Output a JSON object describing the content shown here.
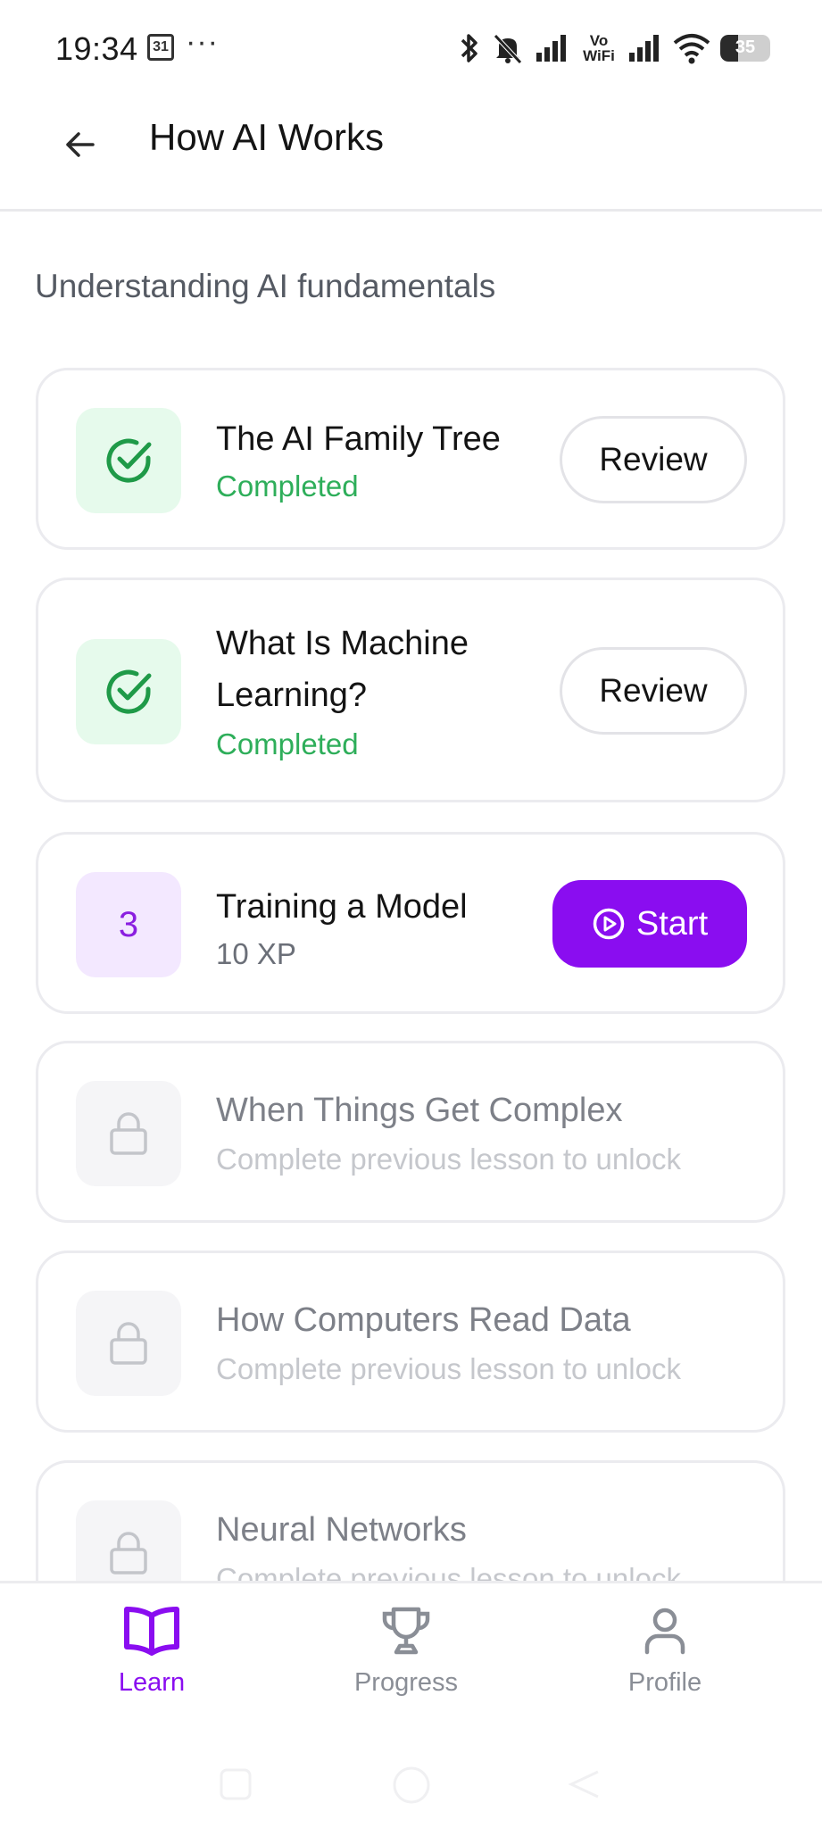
{
  "status_bar": {
    "time": "19:34",
    "calendar_day": "31",
    "more": "···",
    "vowifi": "Vo\nWiFi",
    "battery_percent": "35",
    "battery_level": 0.35
  },
  "header": {
    "back_icon": "arrow-left-icon",
    "title": "How AI Works"
  },
  "subtitle": "Understanding AI fundamentals",
  "lessons": [
    {
      "title": "The AI Family Tree",
      "status": "Completed",
      "state": "completed",
      "action": "Review",
      "icon": "check-circle-icon"
    },
    {
      "title": "What Is Machine\nLearning?",
      "title_line1": "What Is Machine",
      "title_line2": "Learning?",
      "status": "Completed",
      "state": "completed",
      "action": "Review",
      "icon": "check-circle-icon"
    },
    {
      "number": "3",
      "title": "Training a Model",
      "status": "10 XP",
      "state": "current",
      "action": "Start",
      "icon": "play-circle-icon"
    },
    {
      "title": "When Things Get Complex",
      "status": "Complete previous lesson to unlock",
      "state": "locked",
      "icon": "lock-icon"
    },
    {
      "title": "How Computers Read Data",
      "status": "Complete previous lesson to unlock",
      "state": "locked",
      "icon": "lock-icon"
    },
    {
      "title": "Neural Networks",
      "status": "Complete previous lesson to unlock",
      "state": "locked",
      "icon": "lock-icon"
    }
  ],
  "bottom_nav": {
    "items": [
      {
        "label": "Learn",
        "icon": "book-open-icon",
        "active": true
      },
      {
        "label": "Progress",
        "icon": "trophy-icon",
        "active": false
      },
      {
        "label": "Profile",
        "icon": "user-icon",
        "active": false
      }
    ]
  },
  "colors": {
    "accent": "#8a0df0",
    "success": "#2eae5a",
    "success_bg": "#e6faec",
    "accent_bg": "#f3e8ff"
  }
}
